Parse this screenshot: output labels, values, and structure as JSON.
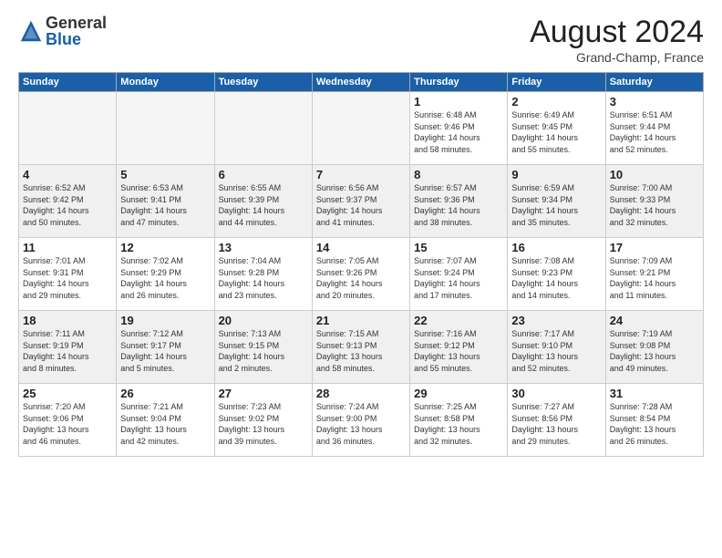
{
  "logo": {
    "general": "General",
    "blue": "Blue"
  },
  "title": "August 2024",
  "location": "Grand-Champ, France",
  "days_header": [
    "Sunday",
    "Monday",
    "Tuesday",
    "Wednesday",
    "Thursday",
    "Friday",
    "Saturday"
  ],
  "weeks": [
    [
      {
        "day": "",
        "info": ""
      },
      {
        "day": "",
        "info": ""
      },
      {
        "day": "",
        "info": ""
      },
      {
        "day": "",
        "info": ""
      },
      {
        "day": "1",
        "info": "Sunrise: 6:48 AM\nSunset: 9:46 PM\nDaylight: 14 hours\nand 58 minutes."
      },
      {
        "day": "2",
        "info": "Sunrise: 6:49 AM\nSunset: 9:45 PM\nDaylight: 14 hours\nand 55 minutes."
      },
      {
        "day": "3",
        "info": "Sunrise: 6:51 AM\nSunset: 9:44 PM\nDaylight: 14 hours\nand 52 minutes."
      }
    ],
    [
      {
        "day": "4",
        "info": "Sunrise: 6:52 AM\nSunset: 9:42 PM\nDaylight: 14 hours\nand 50 minutes."
      },
      {
        "day": "5",
        "info": "Sunrise: 6:53 AM\nSunset: 9:41 PM\nDaylight: 14 hours\nand 47 minutes."
      },
      {
        "day": "6",
        "info": "Sunrise: 6:55 AM\nSunset: 9:39 PM\nDaylight: 14 hours\nand 44 minutes."
      },
      {
        "day": "7",
        "info": "Sunrise: 6:56 AM\nSunset: 9:37 PM\nDaylight: 14 hours\nand 41 minutes."
      },
      {
        "day": "8",
        "info": "Sunrise: 6:57 AM\nSunset: 9:36 PM\nDaylight: 14 hours\nand 38 minutes."
      },
      {
        "day": "9",
        "info": "Sunrise: 6:59 AM\nSunset: 9:34 PM\nDaylight: 14 hours\nand 35 minutes."
      },
      {
        "day": "10",
        "info": "Sunrise: 7:00 AM\nSunset: 9:33 PM\nDaylight: 14 hours\nand 32 minutes."
      }
    ],
    [
      {
        "day": "11",
        "info": "Sunrise: 7:01 AM\nSunset: 9:31 PM\nDaylight: 14 hours\nand 29 minutes."
      },
      {
        "day": "12",
        "info": "Sunrise: 7:02 AM\nSunset: 9:29 PM\nDaylight: 14 hours\nand 26 minutes."
      },
      {
        "day": "13",
        "info": "Sunrise: 7:04 AM\nSunset: 9:28 PM\nDaylight: 14 hours\nand 23 minutes."
      },
      {
        "day": "14",
        "info": "Sunrise: 7:05 AM\nSunset: 9:26 PM\nDaylight: 14 hours\nand 20 minutes."
      },
      {
        "day": "15",
        "info": "Sunrise: 7:07 AM\nSunset: 9:24 PM\nDaylight: 14 hours\nand 17 minutes."
      },
      {
        "day": "16",
        "info": "Sunrise: 7:08 AM\nSunset: 9:23 PM\nDaylight: 14 hours\nand 14 minutes."
      },
      {
        "day": "17",
        "info": "Sunrise: 7:09 AM\nSunset: 9:21 PM\nDaylight: 14 hours\nand 11 minutes."
      }
    ],
    [
      {
        "day": "18",
        "info": "Sunrise: 7:11 AM\nSunset: 9:19 PM\nDaylight: 14 hours\nand 8 minutes."
      },
      {
        "day": "19",
        "info": "Sunrise: 7:12 AM\nSunset: 9:17 PM\nDaylight: 14 hours\nand 5 minutes."
      },
      {
        "day": "20",
        "info": "Sunrise: 7:13 AM\nSunset: 9:15 PM\nDaylight: 14 hours\nand 2 minutes."
      },
      {
        "day": "21",
        "info": "Sunrise: 7:15 AM\nSunset: 9:13 PM\nDaylight: 13 hours\nand 58 minutes."
      },
      {
        "day": "22",
        "info": "Sunrise: 7:16 AM\nSunset: 9:12 PM\nDaylight: 13 hours\nand 55 minutes."
      },
      {
        "day": "23",
        "info": "Sunrise: 7:17 AM\nSunset: 9:10 PM\nDaylight: 13 hours\nand 52 minutes."
      },
      {
        "day": "24",
        "info": "Sunrise: 7:19 AM\nSunset: 9:08 PM\nDaylight: 13 hours\nand 49 minutes."
      }
    ],
    [
      {
        "day": "25",
        "info": "Sunrise: 7:20 AM\nSunset: 9:06 PM\nDaylight: 13 hours\nand 46 minutes."
      },
      {
        "day": "26",
        "info": "Sunrise: 7:21 AM\nSunset: 9:04 PM\nDaylight: 13 hours\nand 42 minutes."
      },
      {
        "day": "27",
        "info": "Sunrise: 7:23 AM\nSunset: 9:02 PM\nDaylight: 13 hours\nand 39 minutes."
      },
      {
        "day": "28",
        "info": "Sunrise: 7:24 AM\nSunset: 9:00 PM\nDaylight: 13 hours\nand 36 minutes."
      },
      {
        "day": "29",
        "info": "Sunrise: 7:25 AM\nSunset: 8:58 PM\nDaylight: 13 hours\nand 32 minutes."
      },
      {
        "day": "30",
        "info": "Sunrise: 7:27 AM\nSunset: 8:56 PM\nDaylight: 13 hours\nand 29 minutes."
      },
      {
        "day": "31",
        "info": "Sunrise: 7:28 AM\nSunset: 8:54 PM\nDaylight: 13 hours\nand 26 minutes."
      }
    ]
  ]
}
